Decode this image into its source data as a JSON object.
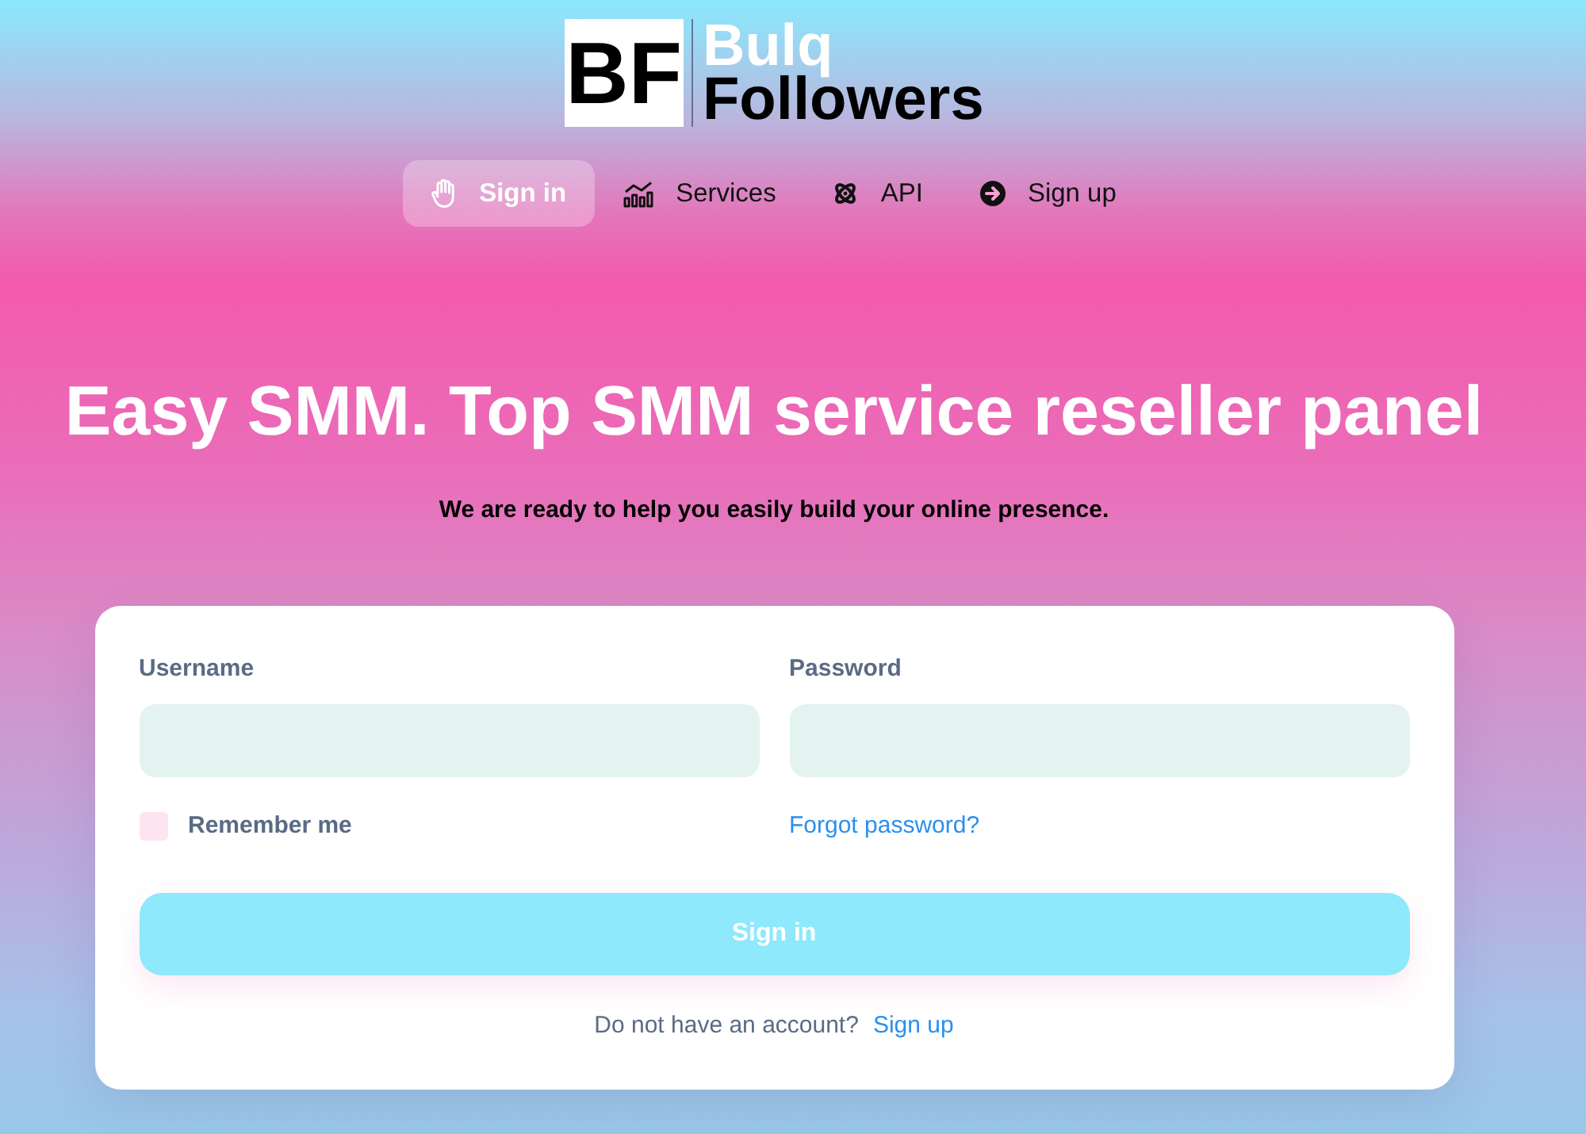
{
  "logo": {
    "mark": "BF",
    "line_1": "Bulq",
    "line_2": "Followers"
  },
  "nav": [
    {
      "label": "Sign in",
      "selected": true
    },
    {
      "label": "Services",
      "selected": false
    },
    {
      "label": "API",
      "selected": false
    },
    {
      "label": "Sign up",
      "selected": false
    }
  ],
  "hero": {
    "title": "Easy SMM. Top SMM service reseller panel",
    "subtitle": "We are ready to help you easily build your online presence."
  },
  "login_form": {
    "fields": [
      {
        "label": "Username"
      },
      {
        "label": "Password"
      }
    ],
    "remember": {
      "label": "Remember me",
      "checked": false
    },
    "forgot_link": "Forgot password?",
    "submit": "Sign in",
    "signup_prompt": "Do not have an account?",
    "signup_link": "Sign up"
  }
}
